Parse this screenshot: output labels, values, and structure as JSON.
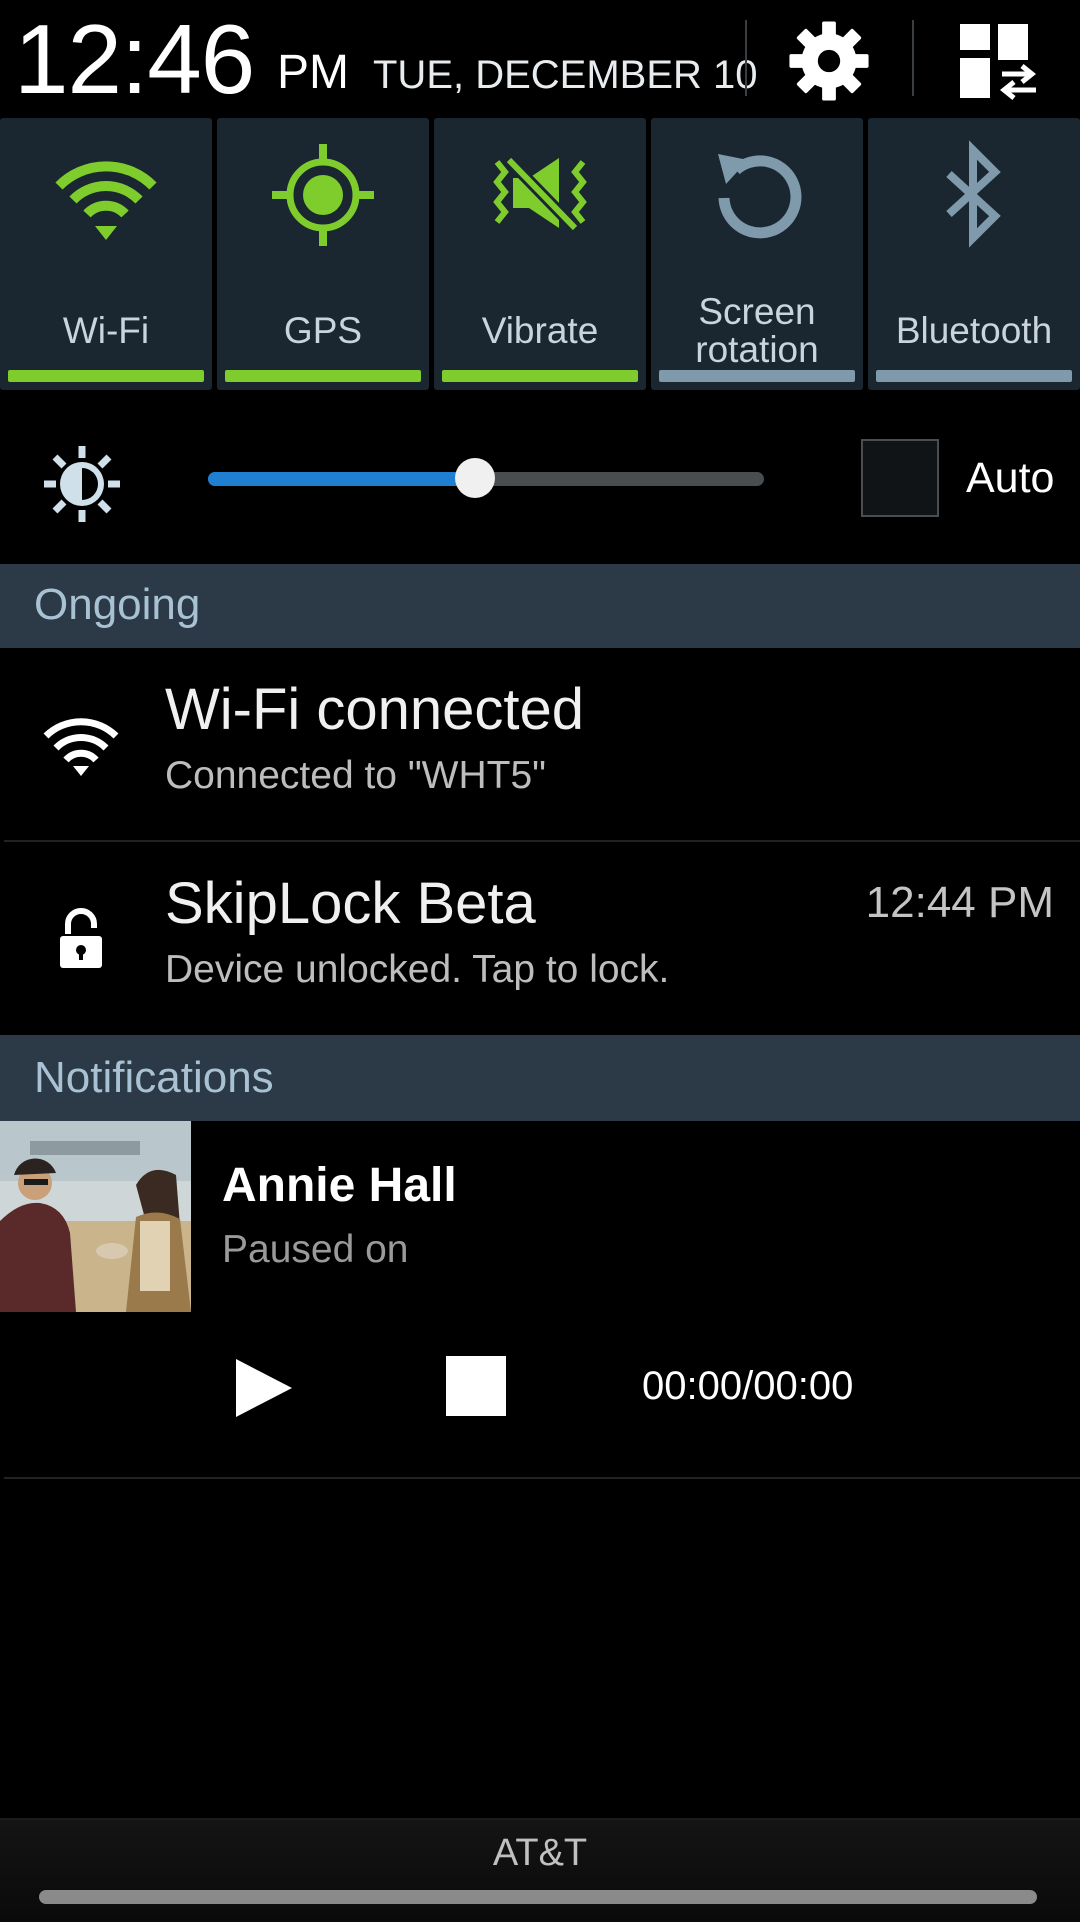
{
  "header": {
    "time": "12:46",
    "ampm": "PM",
    "date": "TUE, DECEMBER 10"
  },
  "quick_toggles": [
    {
      "label": "Wi-Fi",
      "icon": "wifi-icon",
      "active": true
    },
    {
      "label": "GPS",
      "icon": "gps-icon",
      "active": true
    },
    {
      "label": "Vibrate",
      "icon": "vibrate-icon",
      "active": true
    },
    {
      "label": "Screen rotation",
      "icon": "screen-rotation-icon",
      "active": false
    },
    {
      "label": "Bluetooth",
      "icon": "bluetooth-icon",
      "active": false
    }
  ],
  "brightness": {
    "level": 0.48,
    "auto_label": "Auto",
    "auto_checked": false
  },
  "sections": {
    "ongoing": "Ongoing",
    "notifications": "Notifications"
  },
  "ongoing": [
    {
      "title": "Wi-Fi connected",
      "subtitle": "Connected to \"WHT5\"",
      "icon": "wifi-icon"
    },
    {
      "title": "SkipLock Beta",
      "subtitle": "Device unlocked. Tap to lock.",
      "time": "12:44 PM",
      "icon": "unlocked-padlock-icon"
    }
  ],
  "media": {
    "title": "Annie Hall",
    "subtitle": "Paused on",
    "time": "00:00/00:00"
  },
  "carrier": "AT&T",
  "colors": {
    "active_green": "#7fcd2c",
    "inactive_blue_grey": "#7f9aab",
    "slider_blue": "#1f7fd0",
    "section_bg": "#2b3a46"
  }
}
